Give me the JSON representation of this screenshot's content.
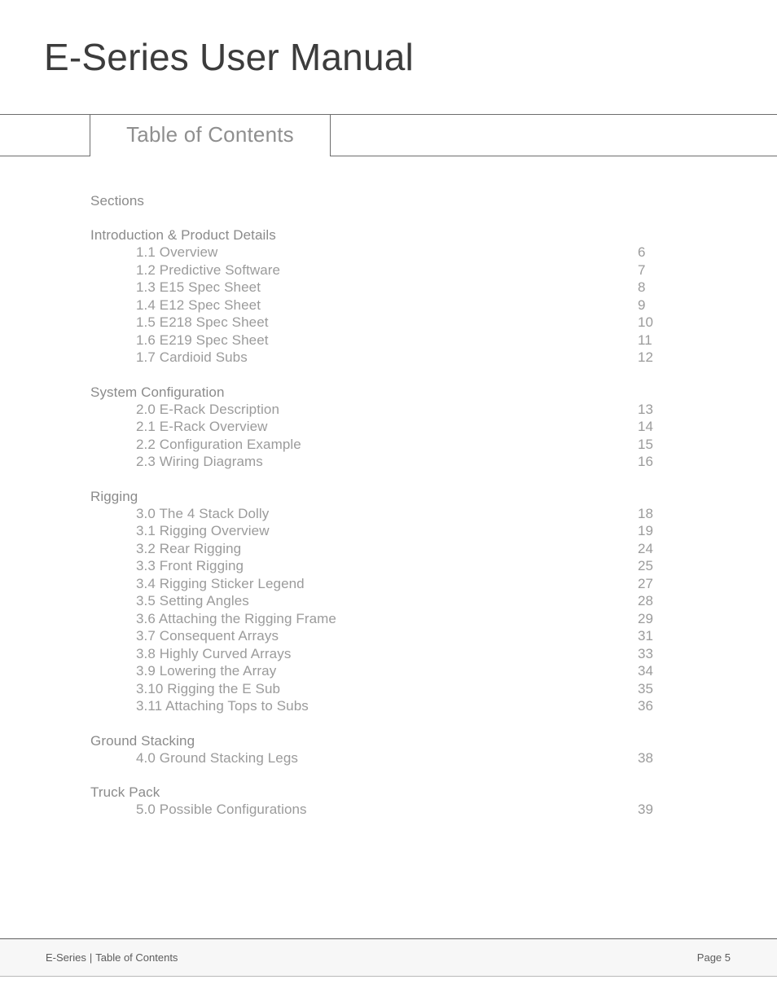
{
  "document": {
    "title": "E-Series User Manual"
  },
  "tabs": {
    "active_label": "Table of Contents"
  },
  "toc": {
    "intro_label": "Sections",
    "groups": [
      {
        "title": "Introduction & Product Details",
        "entries": [
          {
            "label": "1.1 Overview",
            "page": "6"
          },
          {
            "label": "1.2 Predictive Software",
            "page": "7"
          },
          {
            "label": "1.3 E15 Spec Sheet",
            "page": "8"
          },
          {
            "label": "1.4 E12 Spec Sheet",
            "page": "9"
          },
          {
            "label": "1.5 E218 Spec Sheet",
            "page": "10"
          },
          {
            "label": "1.6 E219 Spec Sheet",
            "page": "11"
          },
          {
            "label": "1.7 Cardioid Subs",
            "page": "12"
          }
        ]
      },
      {
        "title": "System Configuration",
        "entries": [
          {
            "label": "2.0 E-Rack Description",
            "page": "13"
          },
          {
            "label": "2.1 E-Rack Overview",
            "page": "14"
          },
          {
            "label": "2.2 Configuration Example",
            "page": "15"
          },
          {
            "label": "2.3 Wiring Diagrams",
            "page": "16"
          }
        ]
      },
      {
        "title": "Rigging",
        "entries": [
          {
            "label": "3.0 The 4 Stack Dolly",
            "page": "18"
          },
          {
            "label": "3.1 Rigging Overview",
            "page": "19"
          },
          {
            "label": "3.2 Rear Rigging",
            "page": "24"
          },
          {
            "label": "3.3 Front Rigging",
            "page": "25"
          },
          {
            "label": "3.4 Rigging Sticker Legend",
            "page": "27"
          },
          {
            "label": "3.5 Setting Angles",
            "page": "28"
          },
          {
            "label": "3.6 Attaching the Rigging Frame",
            "page": "29"
          },
          {
            "label": "3.7 Consequent Arrays",
            "page": "31"
          },
          {
            "label": "3.8 Highly Curved Arrays",
            "page": "33"
          },
          {
            "label": "3.9 Lowering the Array",
            "page": "34"
          },
          {
            "label": "3.10 Rigging the E Sub",
            "page": "35"
          },
          {
            "label": "3.11 Attaching Tops to Subs",
            "page": "36"
          }
        ]
      },
      {
        "title": "Ground Stacking",
        "entries": [
          {
            "label": "4.0 Ground Stacking Legs",
            "page": "38"
          }
        ]
      },
      {
        "title": "Truck Pack",
        "entries": [
          {
            "label": "5.0 Possible Configurations",
            "page": "39"
          }
        ]
      }
    ]
  },
  "footer": {
    "product": "E-Series",
    "separator": "|",
    "section": "Table of Contents",
    "page_label": "Page 5"
  },
  "colors": {
    "title_text": "#3c3c3c",
    "body_text": "#8b8b8b",
    "entry_text": "#9b9b9b",
    "rule": "#6d6d6d",
    "footer_bg": "#f7f7f7",
    "footer_text": "#5c5c5c"
  }
}
